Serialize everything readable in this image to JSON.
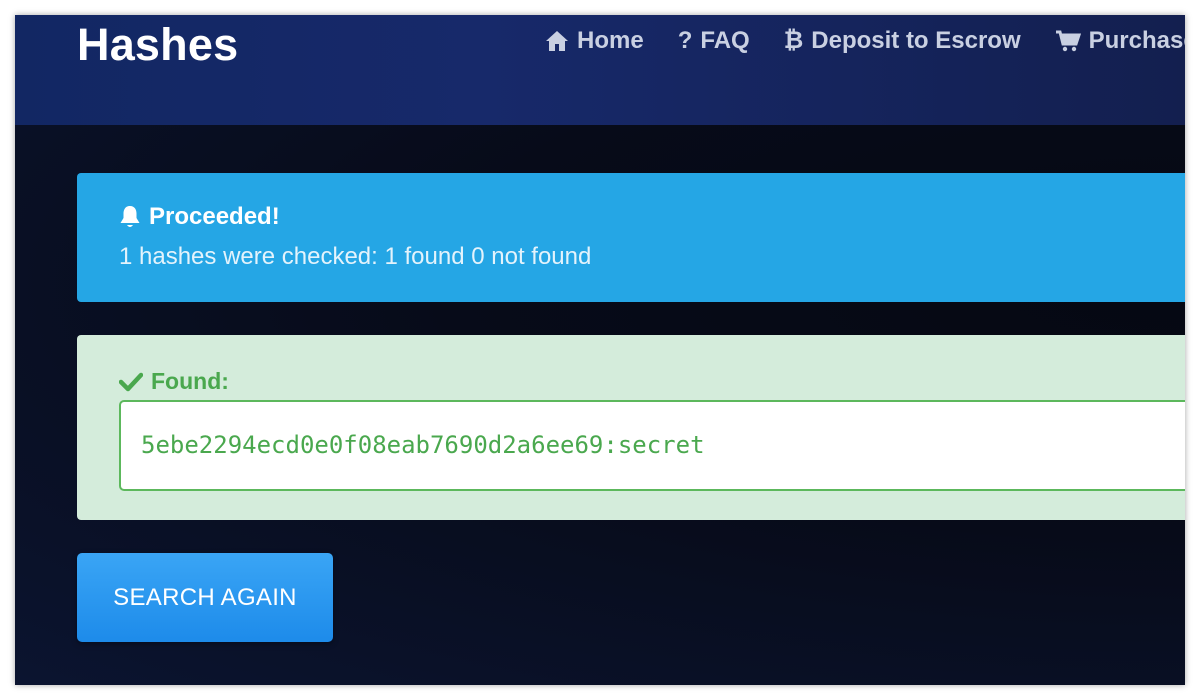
{
  "header": {
    "brand": "Hashes",
    "nav": [
      {
        "label": "Home",
        "icon": "home-icon"
      },
      {
        "label": "FAQ",
        "icon": "question-icon"
      },
      {
        "label": "Deposit to Escrow",
        "icon": "bitcoin-icon"
      },
      {
        "label": "Purchase",
        "icon": "cart-icon"
      }
    ]
  },
  "info_alert": {
    "title": "Proceeded!",
    "message": "1 hashes were checked: 1 found 0 not found",
    "icon": "bell-icon",
    "color": "#25a6e5"
  },
  "found_alert": {
    "label": "Found:",
    "icon": "check-icon",
    "result": "5ebe2294ecd0e0f08eab7690d2a6ee69:secret",
    "color": "#d4ecdb",
    "text_color": "#4aa84e"
  },
  "actions": {
    "search_again_label": "SEARCH AGAIN"
  }
}
